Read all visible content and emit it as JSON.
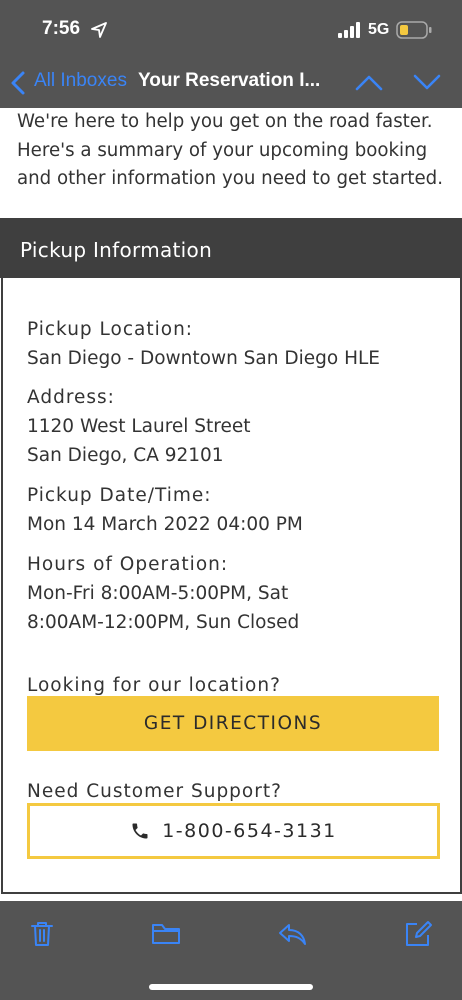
{
  "status_bar": {
    "time": "7:56",
    "network": "5G"
  },
  "nav": {
    "back_label": "All Inboxes",
    "title": "Your Reservation I..."
  },
  "intro": {
    "line1": "We're here to help you get on the road faster.",
    "line2": "Here's a summary of your upcoming booking",
    "line3": "and other information you need to get started."
  },
  "pickup": {
    "section_title": "Pickup Information",
    "location_label": "Pickup Location:",
    "location_value": "San Diego - Downtown San Diego HLE",
    "address_label": "Address:",
    "address_line1": "1120 West Laurel Street",
    "address_line2": "San Diego, CA 92101",
    "datetime_label": "Pickup Date/Time:",
    "datetime_value": "Mon 14 March 2022 04:00 PM",
    "hours_label": "Hours of Operation:",
    "hours_line1": "Mon-Fri 8:00AM-5:00PM, Sat",
    "hours_line2": "8:00AM-12:00PM, Sun Closed",
    "directions_prompt": "Looking for our location?",
    "directions_button": "GET DIRECTIONS",
    "support_prompt": "Need Customer Support?",
    "phone_number": "1-800-654-3131"
  },
  "toolbar": {
    "icons": [
      "trash-icon",
      "folder-icon",
      "reply-icon",
      "compose-icon"
    ]
  },
  "colors": {
    "accent_blue": "#3a84f6",
    "brand_yellow": "#f4c940",
    "chrome_gray": "#545454",
    "header_dark": "#3f3f3f"
  }
}
